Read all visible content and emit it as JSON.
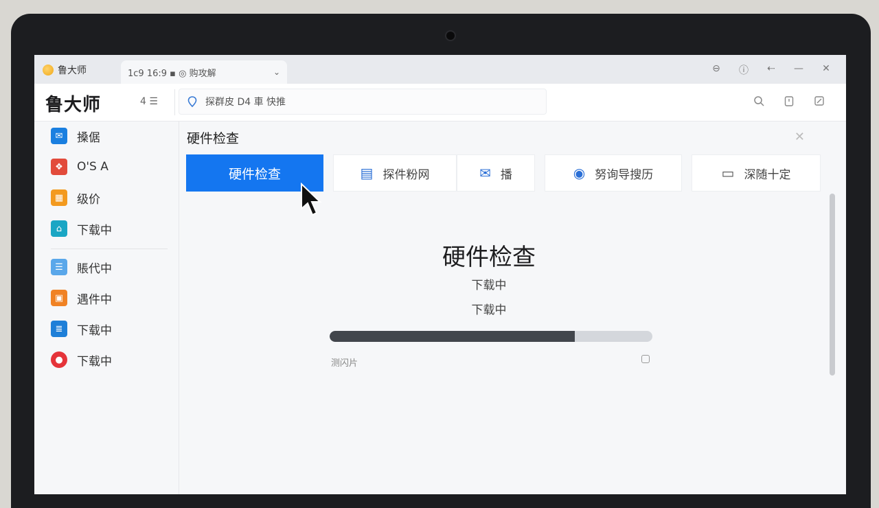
{
  "window": {
    "app_tab_label": "鲁大师",
    "active_tab_label": "1c9 16:9 ▪ ◎ 购攻解",
    "controls": [
      "⊖",
      "ⓘ",
      "⇠",
      "—",
      "✕"
    ]
  },
  "header": {
    "brand": "鲁大师",
    "count": "4 ☰",
    "search_text": "探群皮  D4 車  快推",
    "icons": [
      "search-icon",
      "clipboard-icon",
      "edit-icon"
    ]
  },
  "sidebar": {
    "items": [
      {
        "label": "搡倨",
        "icon": "mail-icon",
        "color": "#1a7fe0"
      },
      {
        "label": "O'S A",
        "icon": "puzzle-icon",
        "color": "#e24b3b"
      },
      {
        "label": "级价",
        "icon": "grid-icon",
        "color": "#f39a1f"
      },
      {
        "label": "下载中",
        "icon": "home-icon",
        "color": "#1aa6c4"
      },
      {
        "label": "賬代中",
        "icon": "list-icon",
        "color": "#5aa7ea"
      },
      {
        "label": "遇件中",
        "icon": "briefcase-icon",
        "color": "#f08224"
      },
      {
        "label": "下载中",
        "icon": "document-icon",
        "color": "#1e7fd8"
      },
      {
        "label": "下载中",
        "icon": "car-icon",
        "color": "#e5343a"
      }
    ]
  },
  "main": {
    "title": "硬件检查",
    "close": "✕",
    "tabs": [
      {
        "label": "硬件检查",
        "active": true
      },
      {
        "label": "探件粉网",
        "active": false
      },
      {
        "label": "播",
        "active": false
      },
      {
        "label": "努询导搜历",
        "active": false
      },
      {
        "label": "深随十定",
        "active": false
      }
    ],
    "big_title": "硬件检查",
    "status_line1": "下载中",
    "status_line2": "下载中",
    "progress": 0.76,
    "progress_caption": "测闪片"
  }
}
